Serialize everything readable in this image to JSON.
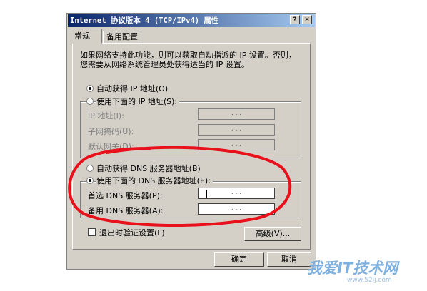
{
  "dialog": {
    "title": "Internet 协议版本 4 (TCP/IPv4) 属性",
    "help_btn": "?",
    "close_btn": "✕",
    "tabs": [
      "常规",
      "备用配置"
    ],
    "intro_line1": "如果网络支持此功能，则可以获取自动指派的 IP 设置。否则，",
    "intro_line2": "您需要从网络系统管理员处获得适当的 IP 设置。",
    "auto_ip": "自动获得 IP 地址(O)",
    "manual_ip": "使用下面的 IP 地址(S):",
    "ip_label": "IP 地址(I):",
    "mask_label": "子网掩码(U):",
    "gateway_label": "默认网关(D):",
    "auto_dns": "自动获得 DNS 服务器地址(B)",
    "manual_dns": "使用下面的 DNS 服务器地址(E):",
    "pref_dns_label": "首选 DNS 服务器(P):",
    "alt_dns_label": "备用 DNS 服务器(A):",
    "ip_dots": ".   .   .",
    "validate_label": "退出时验证设置(L)",
    "advanced_btn": "高级(V)...",
    "ok_btn": "确定",
    "cancel_btn": "取消",
    "selected_ip_mode": "auto",
    "selected_dns_mode": "manual",
    "validate_checked": false
  },
  "watermark": {
    "brand": "我爱IT技术网",
    "url": "www.52ij.com"
  },
  "colors": {
    "titlebar_start": "#0a246a",
    "titlebar_end": "#a6caf0",
    "window_bg": "#d4d0c8",
    "annotation": "#e8101a"
  }
}
